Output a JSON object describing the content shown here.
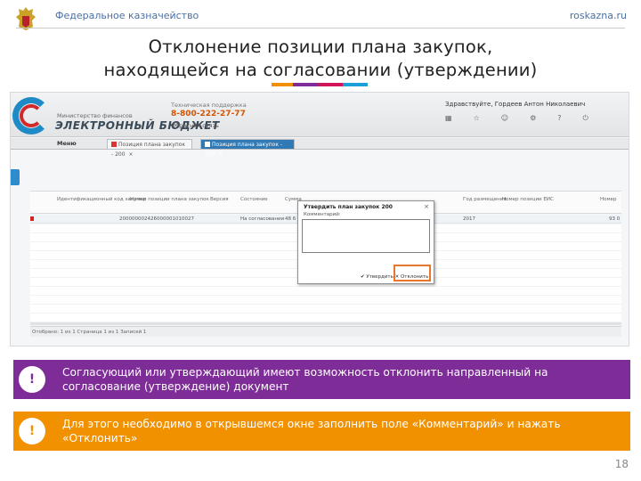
{
  "header": {
    "organization": "Федеральное казначейство",
    "website": "roskazna.ru",
    "title_line1": "Отклонение позиции плана закупок,",
    "title_line2": "находящейся на согласовании (утверждении)"
  },
  "accent_colors": [
    "#f29100",
    "#7e2c97",
    "#d4145a",
    "#1a9fd6",
    "#20b2aa"
  ],
  "screenshot": {
    "logo_subtitle": "Министерство финансов",
    "logo_name": "ЭЛЕКТРОННЫЙ БЮДЖЕТ",
    "phone_label": "Техническая поддержка",
    "phone": "8-800-222-27-77",
    "feedback": "Обратная связь",
    "greeting": "Здравствуйте, Гордеев Антон Николаевич",
    "top_icons": [
      "grid-icon",
      "star-icon",
      "user-icon",
      "settings-icon",
      "help-icon",
      "logout-icon"
    ],
    "menu_label": "Меню",
    "tabs": [
      {
        "label": "Позиция плана закупок - 200",
        "active": false
      },
      {
        "label": "Позиция плана закупок - 200",
        "active": true
      }
    ],
    "columns": [
      "Идентификационный код закупки",
      "Номер позиции плана закупок",
      "Версия",
      "Состояние",
      "Сумма",
      "Год размещения",
      "Номер позиции ЕИС",
      "Номер"
    ],
    "row": {
      "code": "200000002426000001010027",
      "status": "На согласовании",
      "sum": "48 6",
      "year": "2017",
      "right": "93 0"
    },
    "status_text": "Отобрано: 1 из 1   Страница 1 из 1   Записей 1",
    "dialog": {
      "title": "Утвердить план закупок 200",
      "comment_label": "Комментарий:",
      "buttons": "✔ Утвердить   ✕ Отклонить"
    }
  },
  "notes": [
    {
      "badge": "!",
      "text": "Согласующий или утверждающий имеют возможность отклонить направленный на согласование (утверждение) документ",
      "color": "#7e2c97"
    },
    {
      "badge": "!",
      "text": "Для этого необходимо в открывшемся окне заполнить поле «Комментарий» и нажать «Отклонить»",
      "color": "#f29100"
    }
  ],
  "page_number": "18"
}
